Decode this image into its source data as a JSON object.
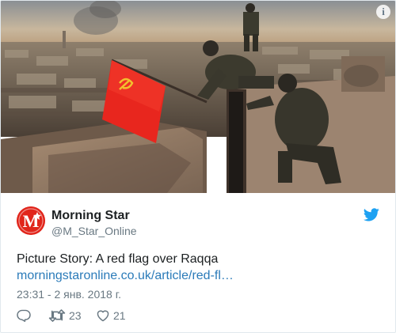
{
  "tweet": {
    "media_alt": "Photo",
    "info_icon": "i",
    "author": {
      "display_name": "Morning Star",
      "handle": "@M_Star_Online",
      "avatar_letter": "M"
    },
    "text": "Picture Story: A red flag over Raqqa",
    "link_text": "morningstaronline.co.uk/article/red-fl…",
    "timestamp": "23:31 - 2 янв. 2018 г.",
    "actions": {
      "retweet_count": "23",
      "like_count": "21"
    },
    "colors": {
      "flag_red": "#e8261e",
      "link_blue": "#2b7bb9",
      "twitter_blue": "#1da1f2",
      "text_dark": "#1c2022",
      "text_muted": "#697882"
    },
    "icons": [
      "info-icon",
      "twitter-bird-icon",
      "reply-icon",
      "retweet-icon",
      "like-icon",
      "hammer-sickle-icon"
    ]
  }
}
